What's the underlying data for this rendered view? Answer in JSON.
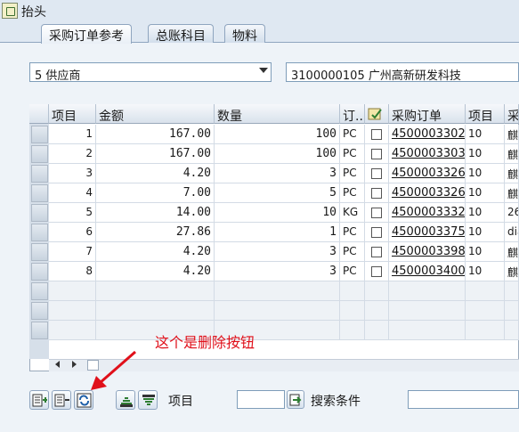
{
  "header": {
    "title": "抬头",
    "icon": "header-toggle-icon"
  },
  "tabs": [
    {
      "label": "采购订单参考",
      "active": true
    },
    {
      "label": "总账科目",
      "active": false
    },
    {
      "label": "物料",
      "active": false
    }
  ],
  "reference_type": {
    "value": "5 供应商"
  },
  "vendor": {
    "value": "3100000105 广州高新研发科技"
  },
  "table": {
    "columns": [
      "项目",
      "金额",
      "数量",
      "订..",
      "",
      "采购订单",
      "项目",
      "采"
    ],
    "rows": [
      {
        "item": "1",
        "amount": "167.00",
        "qty": "100",
        "unit": "PC",
        "po": "4500003302",
        "po_item": "10",
        "extra": "麒"
      },
      {
        "item": "2",
        "amount": "167.00",
        "qty": "100",
        "unit": "PC",
        "po": "4500003303",
        "po_item": "10",
        "extra": "麒"
      },
      {
        "item": "3",
        "amount": "4.20",
        "qty": "3",
        "unit": "PC",
        "po": "4500003326",
        "po_item": "10",
        "extra": "麒"
      },
      {
        "item": "4",
        "amount": "7.00",
        "qty": "5",
        "unit": "PC",
        "po": "4500003326",
        "po_item": "10",
        "extra": "麒"
      },
      {
        "item": "5",
        "amount": "14.00",
        "qty": "10",
        "unit": "KG",
        "po": "4500003332",
        "po_item": "10",
        "extra": "26"
      },
      {
        "item": "6",
        "amount": "27.86",
        "qty": "1",
        "unit": "PC",
        "po": "4500003375",
        "po_item": "10",
        "extra": "dia"
      },
      {
        "item": "7",
        "amount": "4.20",
        "qty": "3",
        "unit": "PC",
        "po": "4500003398",
        "po_item": "10",
        "extra": "麒"
      },
      {
        "item": "8",
        "amount": "4.20",
        "qty": "3",
        "unit": "PC",
        "po": "4500003400",
        "po_item": "10",
        "extra": "麒"
      }
    ]
  },
  "annotation": {
    "text": "这个是删除按钮",
    "color": "#e0101a"
  },
  "toolbar": {
    "item_label": "项目",
    "item_value": "",
    "search_label": "搜索条件",
    "search_value": ""
  }
}
